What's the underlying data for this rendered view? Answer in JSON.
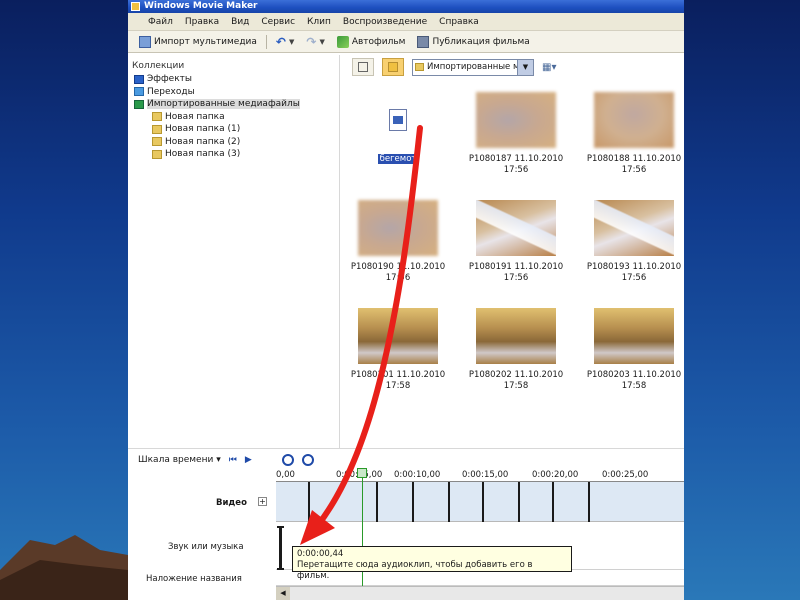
{
  "window": {
    "title": "Windows Movie Maker"
  },
  "menu": [
    "Файл",
    "Правка",
    "Вид",
    "Сервис",
    "Клип",
    "Воспроизведение",
    "Справка"
  ],
  "toolbar": {
    "import_label": "Импорт мультимедиа",
    "automovie_label": "Автофильм",
    "publish_label": "Публикация фильма"
  },
  "collections": {
    "header": "Коллекции",
    "items": [
      {
        "label": "Эффекты",
        "icon": "effects-icon"
      },
      {
        "label": "Переходы",
        "icon": "transitions-icon"
      },
      {
        "label": "Импортированные медиафайлы",
        "icon": "media-icon",
        "selected": true
      }
    ],
    "folders": [
      "Новая папка",
      "Новая папка (1)",
      "Новая папка (2)",
      "Новая папка (3)"
    ]
  },
  "content_header": {
    "collection_select": "Импортированные м"
  },
  "thumbnails": [
    {
      "line1": "бегемот",
      "line2": "",
      "kind": "audio",
      "selected": true
    },
    {
      "line1": "P1080187 11.10.2010",
      "line2": "17:56",
      "kind": "blur-a"
    },
    {
      "line1": "P1080188 11.10.2010",
      "line2": "17:56",
      "kind": "blur-b"
    },
    {
      "line1": "P1080190 11.10.2010",
      "line2": "17:56",
      "kind": "blur-a"
    },
    {
      "line1": "P1080191 11.10.2010",
      "line2": "17:56",
      "kind": "paper"
    },
    {
      "line1": "P1080193 11.10.2010",
      "line2": "17:56",
      "kind": "paper"
    },
    {
      "line1": "P1080201 11.10.2010",
      "line2": "17:58",
      "kind": "stone"
    },
    {
      "line1": "P1080202 11.10.2010",
      "line2": "17:58",
      "kind": "stone"
    },
    {
      "line1": "P1080203 11.10.2010",
      "line2": "17:58",
      "kind": "stone"
    }
  ],
  "timeline": {
    "mode_label": "Шкала времени",
    "ruler": [
      "0,00",
      "0:00:05,00",
      "0:00:10,00",
      "0:00:15,00",
      "0:00:20,00",
      "0:00:25,00"
    ],
    "tracks": {
      "video": "Видео",
      "audio": "Звук или музыка",
      "title": "Наложение названия"
    },
    "tooltip_time": "0:00:00,44",
    "tooltip_text": "Перетащите сюда аудиоклип, чтобы добавить его в фильм."
  },
  "colors": {
    "slide_background": "#103a8c",
    "titlebar": "#1d4fbf",
    "annotation_arrow": "#e8201a"
  }
}
